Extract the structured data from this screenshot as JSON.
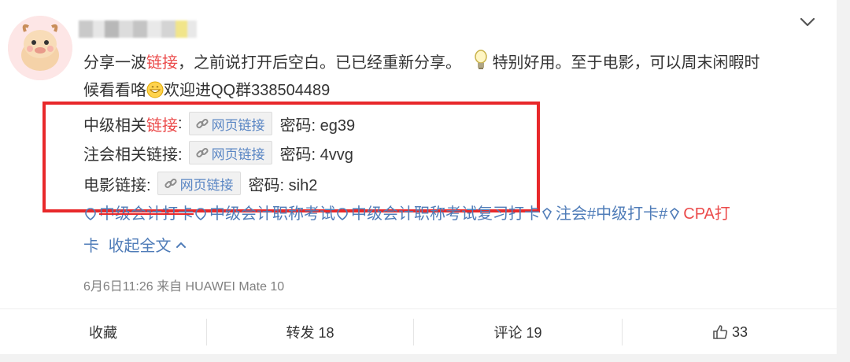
{
  "post": {
    "username": "",
    "text_line1": {
      "part1": "分享一波",
      "link": "链接",
      "part2": "，之前说打开后空白。已已经重新分享。",
      "part3": "特别好用。至于电影，可以周末闲暇时"
    },
    "text_line2": {
      "part1": "候看看咯",
      "part2": "欢迎进QQ群338504489"
    },
    "links": [
      {
        "label_prefix": "中级相关",
        "label_link": "链接",
        "label_suffix": ":",
        "button": "网页链接",
        "password": "密码: eg39"
      },
      {
        "label": "注会相关链接:",
        "button": "网页链接",
        "password": "密码: 4vvg"
      },
      {
        "label": "电影链接:",
        "button": "网页链接",
        "password": "密码: sih2"
      }
    ],
    "tags": [
      "中级会计打卡",
      "中级会计职称考试",
      "中级会计职称考试复习打卡",
      "注会#中级打卡#",
      "CPA打"
    ],
    "tags_line2": {
      "continuation": "卡",
      "collapse": "收起全文"
    },
    "meta": "6月6日11:26 来自 HUAWEI Mate 10"
  },
  "actions": {
    "favorite": "收藏",
    "repost": "转发 18",
    "comment": "评论 19",
    "like_count": "33"
  },
  "colors": {
    "highlight_box": "#e8282a",
    "link_red": "#eb4b4b",
    "link_blue": "#4f7cb8"
  }
}
